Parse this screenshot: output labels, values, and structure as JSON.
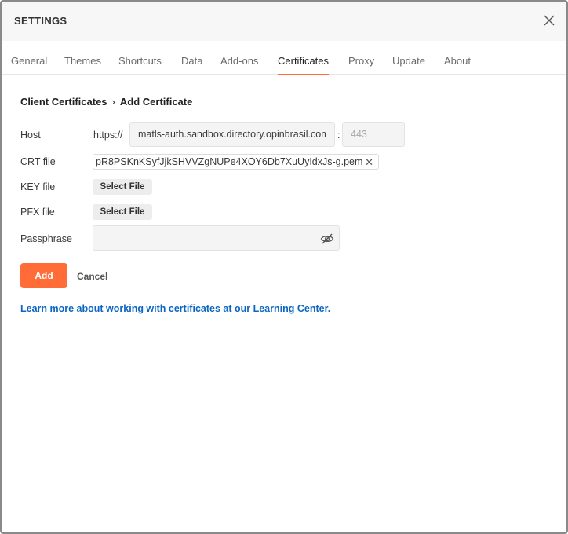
{
  "window": {
    "title": "SETTINGS"
  },
  "tabs": [
    {
      "label": "General"
    },
    {
      "label": "Themes"
    },
    {
      "label": "Shortcuts"
    },
    {
      "label": "Data"
    },
    {
      "label": "Add-ons"
    },
    {
      "label": "Certificates",
      "active": true
    },
    {
      "label": "Proxy"
    },
    {
      "label": "Update"
    },
    {
      "label": "About"
    }
  ],
  "breadcrumb": {
    "parent": "Client Certificates",
    "separator": "›",
    "current": "Add Certificate"
  },
  "form": {
    "host": {
      "label": "Host",
      "prefix": "https://",
      "value": "matls-auth.sandbox.directory.opinbrasil.com.br",
      "port_placeholder": "443",
      "colon": ":"
    },
    "crt": {
      "label": "CRT file",
      "file_name": "pR8PSKnKSyfJjkSHVVZgNUPe4XOY6Db7XuUyIdxJs-g.pem",
      "remove_glyph": "✕"
    },
    "key": {
      "label": "KEY file",
      "button": "Select File"
    },
    "pfx": {
      "label": "PFX file",
      "button": "Select File"
    },
    "passphrase": {
      "label": "Passphrase",
      "value": "",
      "icon": "eye-off-icon"
    }
  },
  "actions": {
    "add": "Add",
    "cancel": "Cancel"
  },
  "learn_link": "Learn more about working with certificates at our Learning Center.",
  "colors": {
    "accent": "#ff6c37",
    "link": "#0b65c2"
  }
}
